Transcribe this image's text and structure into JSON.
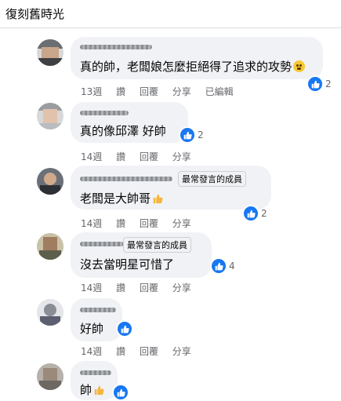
{
  "page": {
    "title": "復刻舊時光"
  },
  "colors": {
    "accent": "#1877f2",
    "bubble": "#f0f2f5",
    "meta": "#65676b"
  },
  "comments": [
    {
      "text": "真的帥，老闆娘怎麼拒絕得了追求的攻勢",
      "reaction_count": "2",
      "actions": {
        "time": "13週",
        "like": "讚",
        "reply": "回覆",
        "share": "分享",
        "edited": "已編輯"
      }
    },
    {
      "text": "真的像邱澤 好帥",
      "reaction_count": "2",
      "actions": {
        "time": "14週",
        "like": "讚",
        "reply": "回覆",
        "share": "分享"
      }
    },
    {
      "badge": "最常發言的成員",
      "text": "老闆是大帥哥",
      "reaction_count": "2",
      "actions": {
        "time": "14週",
        "like": "讚",
        "reply": "回覆",
        "share": "分享"
      }
    },
    {
      "badge": "最常發言的成員",
      "text": "沒去當明星可惜了",
      "reaction_count": "4",
      "actions": {
        "time": "14週",
        "like": "讚",
        "reply": "回覆",
        "share": "分享"
      }
    },
    {
      "text": "好帥",
      "actions": {
        "time": "14週",
        "like": "讚",
        "reply": "回覆",
        "share": "分享"
      }
    },
    {
      "text": "帥"
    }
  ]
}
